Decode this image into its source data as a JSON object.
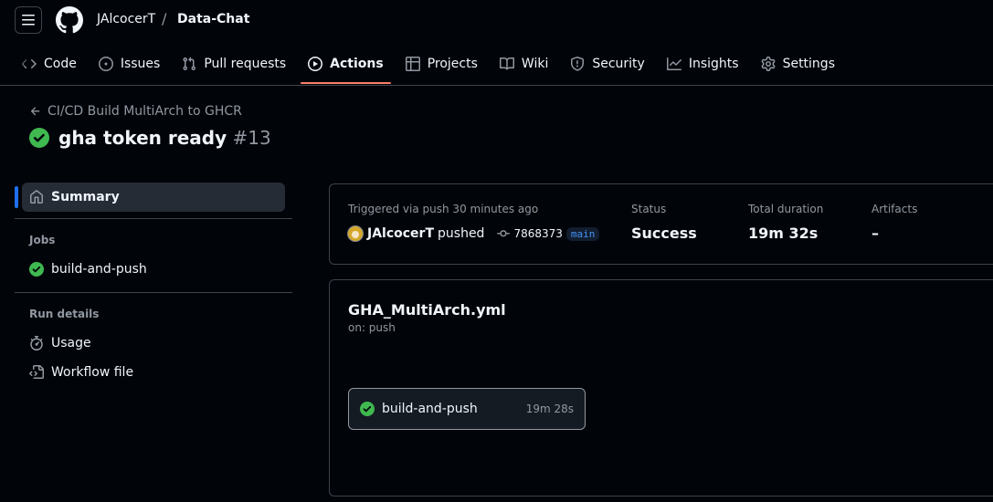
{
  "header": {
    "owner": "JAlcocerT",
    "separator": "/",
    "repo": "Data-Chat"
  },
  "tabs": [
    {
      "label": "Code",
      "icon": "code-icon"
    },
    {
      "label": "Issues",
      "icon": "issue-icon"
    },
    {
      "label": "Pull requests",
      "icon": "pull-request-icon"
    },
    {
      "label": "Actions",
      "icon": "play-icon",
      "active": true
    },
    {
      "label": "Projects",
      "icon": "table-icon"
    },
    {
      "label": "Wiki",
      "icon": "book-icon"
    },
    {
      "label": "Security",
      "icon": "shield-icon"
    },
    {
      "label": "Insights",
      "icon": "graph-icon"
    },
    {
      "label": "Settings",
      "icon": "gear-icon"
    }
  ],
  "run": {
    "workflow_link": "CI/CD Build MultiArch to GHCR",
    "title": "gha token ready",
    "number": "#13"
  },
  "sidebar": {
    "summary": "Summary",
    "jobs_heading": "Jobs",
    "job": "build-and-push",
    "details_heading": "Run details",
    "usage": "Usage",
    "workflow_file": "Workflow file"
  },
  "summary_card": {
    "trigger": "Triggered via push 30 minutes ago",
    "actor": "JAlcocerT",
    "action": "pushed",
    "commit": "7868373",
    "branch": "main",
    "status_label": "Status",
    "status_value": "Success",
    "duration_label": "Total duration",
    "duration_value": "19m 32s",
    "artifacts_label": "Artifacts",
    "artifacts_value": "–"
  },
  "workflow_card": {
    "file": "GHA_MultiArch.yml",
    "event": "on: push",
    "job_name": "build-and-push",
    "job_duration": "19m 28s"
  },
  "colors": {
    "success": "#3fb950",
    "active_tab_underline": "#f78166",
    "selected_marker": "#1f6feb"
  }
}
